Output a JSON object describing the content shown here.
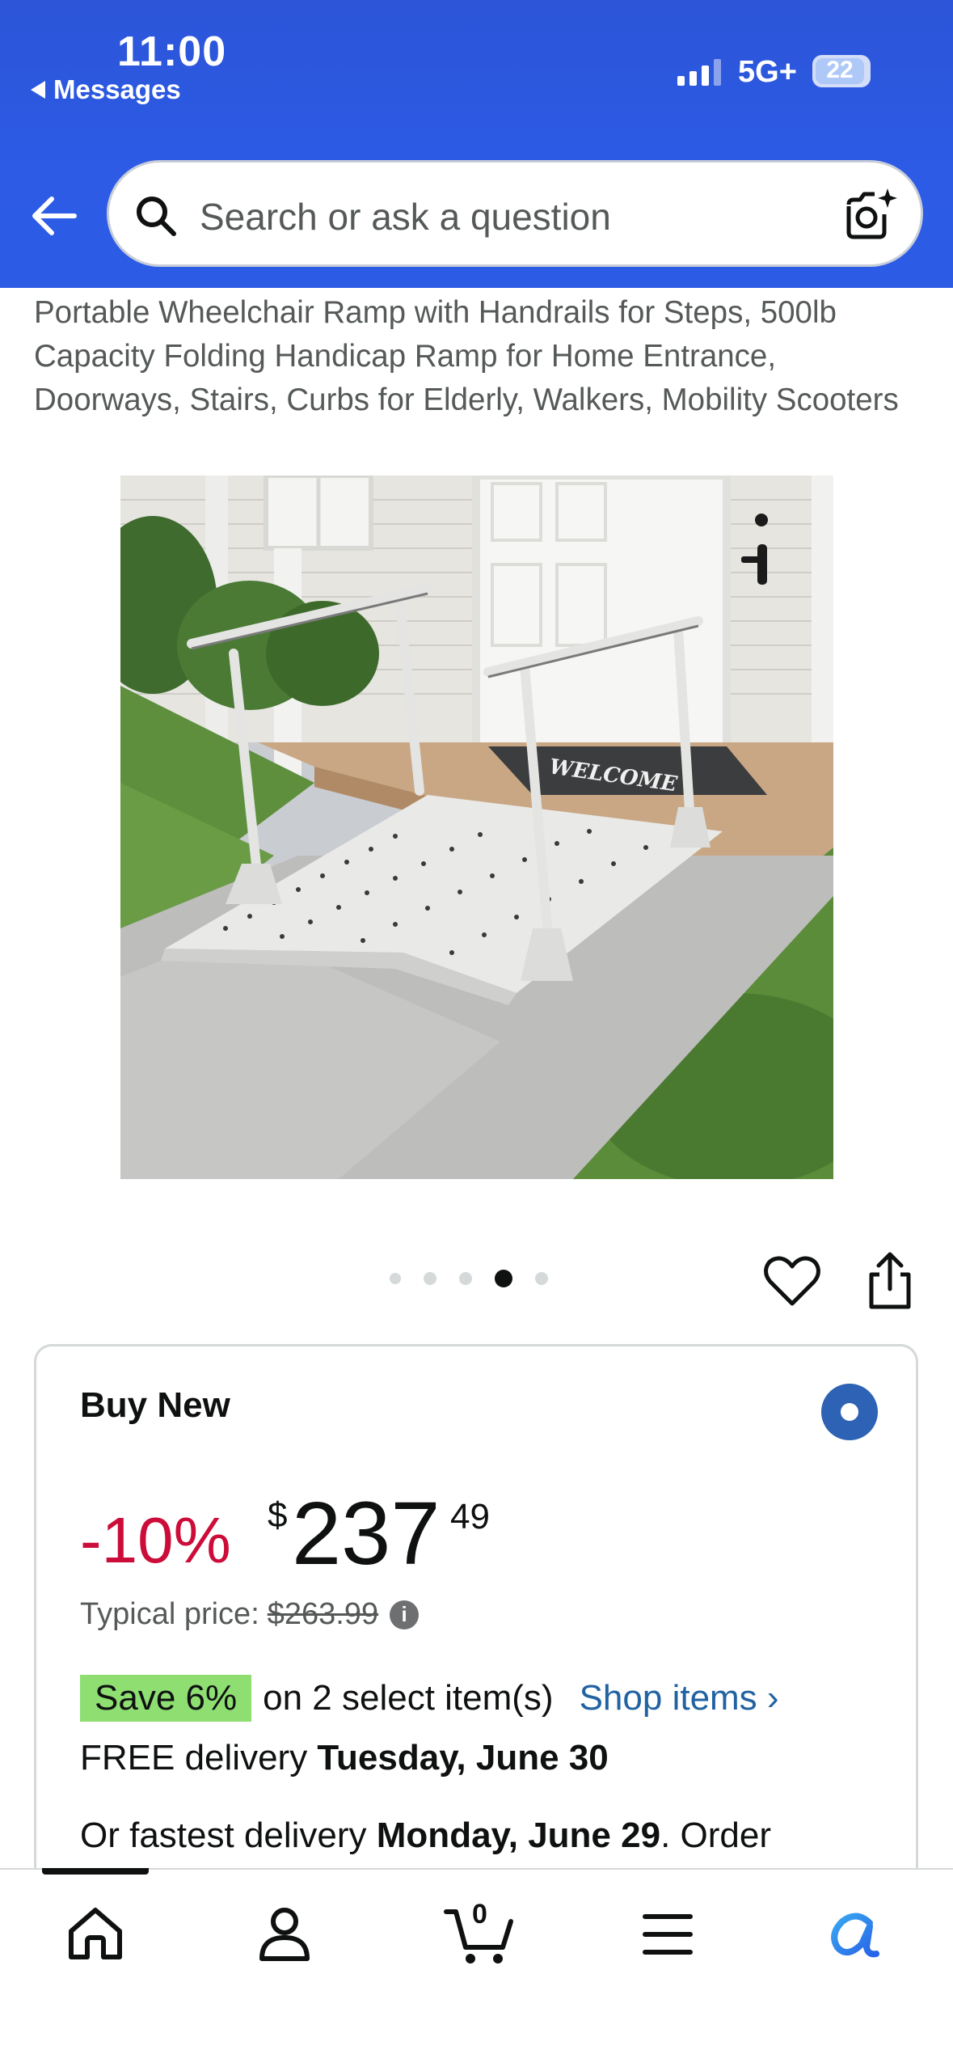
{
  "status_bar": {
    "time": "11:00",
    "back_app": "Messages",
    "network": "5G+",
    "battery": "22"
  },
  "search": {
    "placeholder": "Search or ask a question"
  },
  "product": {
    "title": "Portable Wheelchair Ramp with Handrails for Steps, 500lb Capacity Folding Handicap Ramp for Home Entrance, Doorways, Stairs, Curbs for Elderly, Walkers, Mobility Scooters",
    "image_sign_text": "WELCOME",
    "image_count": 5,
    "image_active_index": 3
  },
  "buy_box": {
    "heading": "Buy New",
    "discount": "-10%",
    "currency": "$",
    "price_whole": "237",
    "price_fraction": "49",
    "typical_label": "Typical price:",
    "typical_price": "$263.99",
    "info_icon": "i",
    "save_badge": "Save 6%",
    "save_text": "on 2 select item(s)",
    "shop_link": "Shop items ›",
    "delivery_prefix": "FREE delivery ",
    "delivery_date": "Tuesday, June 30",
    "fastest_prefix": "Or fastest delivery ",
    "fastest_date": "Monday, June 29",
    "fastest_suffix": ". Order"
  },
  "bottom_nav": {
    "cart_count": "0",
    "items": [
      "home-icon",
      "account-icon",
      "cart-icon",
      "menu-icon",
      "rufus-icon"
    ]
  },
  "colors": {
    "header": "#2d5be6",
    "discount": "#cc0c39",
    "save_badge": "#8ede72",
    "link": "#2162a1",
    "radio": "#2d62b4"
  }
}
